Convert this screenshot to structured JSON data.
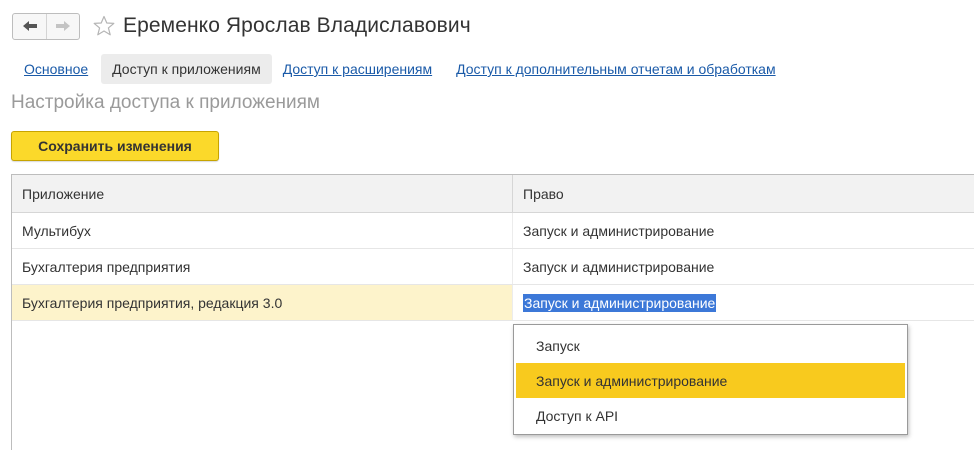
{
  "header": {
    "back_icon": "arrow-left-icon",
    "forward_icon": "arrow-right-icon",
    "favorite_icon": "star-icon",
    "title": "Еременко Ярослав Владиславович"
  },
  "tabs": [
    {
      "label": "Основное",
      "active": false
    },
    {
      "label": "Доступ к приложениям",
      "active": true
    },
    {
      "label": "Доступ к расширениям",
      "active": false
    },
    {
      "label": "Доступ к дополнительным отчетам и обработкам",
      "active": false
    }
  ],
  "section_title": "Настройка доступа к приложениям",
  "toolbar": {
    "save_label": "Сохранить изменения"
  },
  "table": {
    "columns": [
      "Приложение",
      "Право"
    ],
    "rows": [
      {
        "application": "Мультибух",
        "right": "Запуск и администрирование",
        "selected": false
      },
      {
        "application": "Бухгалтерия предприятия",
        "right": "Запуск и администрирование",
        "selected": false
      },
      {
        "application": "Бухгалтерия предприятия, редакция 3.0",
        "right": "Запуск и администрирование",
        "selected": true
      }
    ]
  },
  "dropdown": {
    "options": [
      "Запуск",
      "Запуск и администрирование",
      "Доступ к API"
    ],
    "highlighted": "Запуск и администрирование"
  },
  "colors": {
    "accent_yellow": "#fbd92a",
    "link_blue": "#1a5aa8",
    "selection_blue": "#3c78d8",
    "selected_row": "#fdf3cb"
  }
}
